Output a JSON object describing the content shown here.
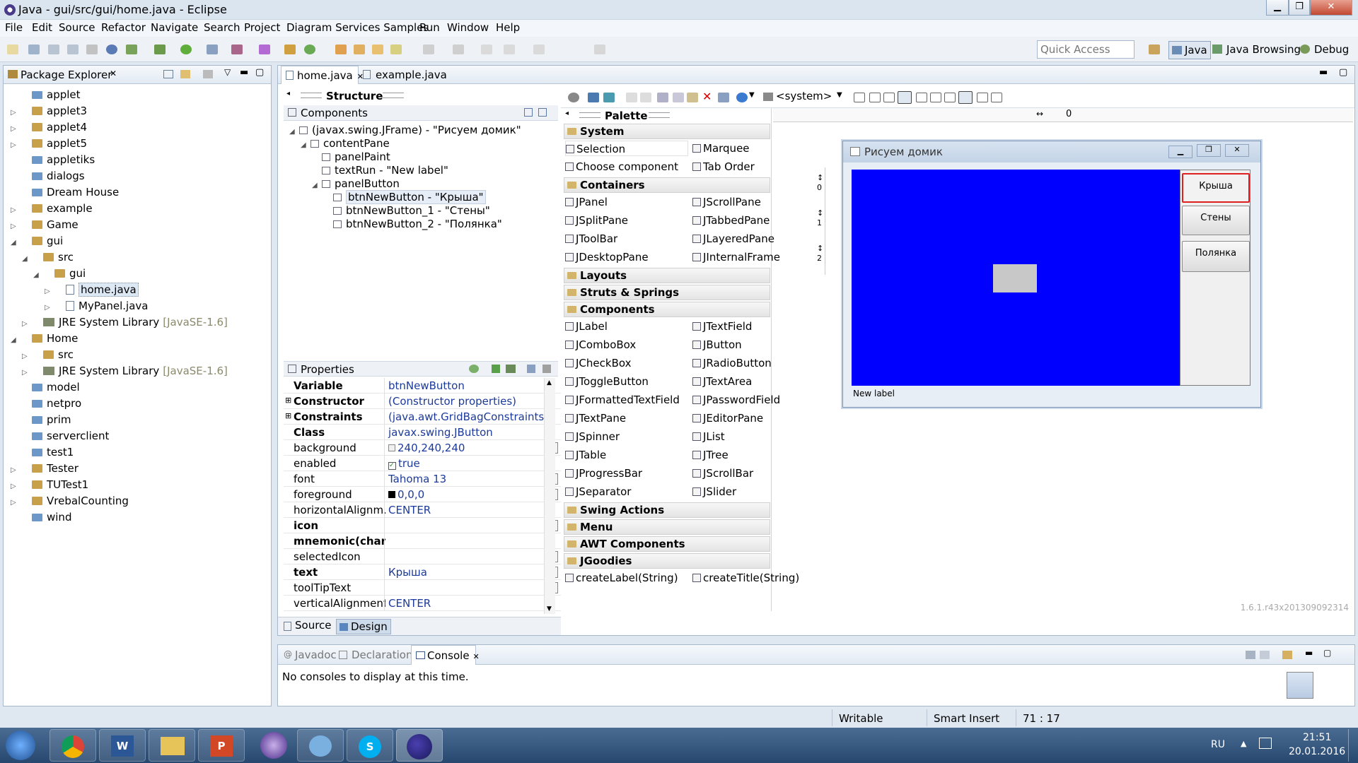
{
  "window": {
    "title": "Java - gui/src/gui/home.java - Eclipse"
  },
  "menu": [
    "File",
    "Edit",
    "Source",
    "Refactor",
    "Navigate",
    "Search",
    "Project",
    "Diagram Services Samples",
    "Run",
    "Window",
    "Help"
  ],
  "quick_access": {
    "placeholder": "Quick Access"
  },
  "perspectives": [
    "Java",
    "Java Browsing",
    "Debug"
  ],
  "package_explorer": {
    "title": "Package Explorer",
    "items": [
      {
        "label": "applet",
        "type": "folder",
        "indent": 0,
        "twisty": ""
      },
      {
        "label": "applet3",
        "type": "pkg",
        "indent": 0,
        "twisty": "▷"
      },
      {
        "label": "applet4",
        "type": "pkg",
        "indent": 0,
        "twisty": "▷"
      },
      {
        "label": "applet5",
        "type": "pkg",
        "indent": 0,
        "twisty": "▷"
      },
      {
        "label": "appletiks",
        "type": "folder",
        "indent": 0,
        "twisty": ""
      },
      {
        "label": "dialogs",
        "type": "folder",
        "indent": 0,
        "twisty": ""
      },
      {
        "label": "Dream House",
        "type": "folder",
        "indent": 0,
        "twisty": ""
      },
      {
        "label": "example",
        "type": "pkg",
        "indent": 0,
        "twisty": "▷"
      },
      {
        "label": "Game",
        "type": "pkg",
        "indent": 0,
        "twisty": "▷"
      },
      {
        "label": "gui",
        "type": "pkg",
        "indent": 0,
        "twisty": "◢"
      },
      {
        "label": "src",
        "type": "pkg",
        "indent": 1,
        "twisty": "◢"
      },
      {
        "label": "gui",
        "type": "pkg",
        "indent": 2,
        "twisty": "◢"
      },
      {
        "label": "home.java",
        "type": "java",
        "indent": 3,
        "twisty": "▷"
      },
      {
        "label": "MyPanel.java",
        "type": "java",
        "indent": 3,
        "twisty": "▷"
      },
      {
        "label": "JRE System Library",
        "suffix": "[JavaSE-1.6]",
        "type": "jre",
        "indent": 1,
        "twisty": "▷"
      },
      {
        "label": "Home",
        "type": "pkg",
        "indent": 0,
        "twisty": "◢"
      },
      {
        "label": "src",
        "type": "pkg",
        "indent": 1,
        "twisty": "▷"
      },
      {
        "label": "JRE System Library",
        "suffix": "[JavaSE-1.6]",
        "type": "jre",
        "indent": 1,
        "twisty": "▷"
      },
      {
        "label": "model",
        "type": "folder",
        "indent": 0,
        "twisty": ""
      },
      {
        "label": "netpro",
        "type": "folder",
        "indent": 0,
        "twisty": ""
      },
      {
        "label": "prim",
        "type": "folder",
        "indent": 0,
        "twisty": ""
      },
      {
        "label": "serverclient",
        "type": "folder",
        "indent": 0,
        "twisty": ""
      },
      {
        "label": "test1",
        "type": "folder",
        "indent": 0,
        "twisty": ""
      },
      {
        "label": "Tester",
        "type": "pkg",
        "indent": 0,
        "twisty": "▷"
      },
      {
        "label": "TUTest1",
        "type": "pkg",
        "indent": 0,
        "twisty": "▷"
      },
      {
        "label": "VrebalCounting",
        "type": "pkg",
        "indent": 0,
        "twisty": "▷"
      },
      {
        "label": "wind",
        "type": "folder",
        "indent": 0,
        "twisty": ""
      }
    ]
  },
  "editor_tabs": [
    "home.java",
    "example.java"
  ],
  "structure": {
    "title": "Structure",
    "components_title": "Components",
    "tree": [
      {
        "label": "(javax.swing.JFrame) - \"Рисуем домик\"",
        "indent": 0,
        "twisty": "◢"
      },
      {
        "label": "contentPane",
        "indent": 1,
        "twisty": "◢"
      },
      {
        "label": "panelPaint",
        "indent": 2,
        "twisty": ""
      },
      {
        "label": "textRun - \"New label\"",
        "indent": 2,
        "twisty": ""
      },
      {
        "label": "panelButton",
        "indent": 2,
        "twisty": "◢"
      },
      {
        "label": "btnNewButton - \"Крыша\"",
        "indent": 3,
        "twisty": ""
      },
      {
        "label": "btnNewButton_1 - \"Стены\"",
        "indent": 3,
        "twisty": ""
      },
      {
        "label": "btnNewButton_2 - \"Полянка\"",
        "indent": 3,
        "twisty": ""
      }
    ]
  },
  "properties": {
    "title": "Properties",
    "rows": [
      {
        "k": "Variable",
        "v": "btnNewButton",
        "bold": true,
        "dots": false,
        "plus": false
      },
      {
        "k": "Constructor",
        "v": "(Constructor properties)",
        "bold": true,
        "dots": false,
        "plus": true
      },
      {
        "k": "Constraints",
        "v": "(java.awt.GridBagConstraints)",
        "bold": true,
        "dots": false,
        "plus": true
      },
      {
        "k": "Class",
        "v": "javax.swing.JButton",
        "bold": true,
        "dots": false,
        "plus": false
      },
      {
        "k": "background",
        "v": "240,240,240",
        "bold": false,
        "dots": true,
        "plus": false
      },
      {
        "k": "enabled",
        "v": "true",
        "bold": false,
        "dots": false,
        "plus": false
      },
      {
        "k": "font",
        "v": "Tahoma 13",
        "bold": false,
        "dots": true,
        "plus": false
      },
      {
        "k": "foreground",
        "v": "0,0,0",
        "bold": false,
        "dots": true,
        "plus": false
      },
      {
        "k": "horizontalAlignm...",
        "v": "CENTER",
        "bold": false,
        "dots": false,
        "plus": false
      },
      {
        "k": "icon",
        "v": "",
        "bold": true,
        "dots": true,
        "plus": false
      },
      {
        "k": "mnemonic(char)",
        "v": "",
        "bold": true,
        "dots": false,
        "plus": false
      },
      {
        "k": "selectedIcon",
        "v": "",
        "bold": false,
        "dots": true,
        "plus": false
      },
      {
        "k": "text",
        "v": "Крыша",
        "bold": true,
        "dots": true,
        "plus": false
      },
      {
        "k": "toolTipText",
        "v": "",
        "bold": false,
        "dots": true,
        "plus": false
      },
      {
        "k": "verticalAlignment",
        "v": "CENTER",
        "bold": false,
        "dots": false,
        "plus": false
      }
    ]
  },
  "palette": {
    "title": "Palette",
    "system_label": "<system>",
    "sections": [
      {
        "name": "System",
        "items": [
          "Selection",
          "Marquee",
          "Choose component",
          "Tab Order"
        ]
      },
      {
        "name": "Containers",
        "items": [
          "JPanel",
          "JScrollPane",
          "JSplitPane",
          "JTabbedPane",
          "JToolBar",
          "JLayeredPane",
          "JDesktopPane",
          "JInternalFrame"
        ]
      },
      {
        "name": "Layouts",
        "items": []
      },
      {
        "name": "Struts & Springs",
        "items": []
      },
      {
        "name": "Components",
        "items": [
          "JLabel",
          "JTextField",
          "JComboBox",
          "JButton",
          "JCheckBox",
          "JRadioButton",
          "JToggleButton",
          "JTextArea",
          "JFormattedTextField",
          "JPasswordField",
          "JTextPane",
          "JEditorPane",
          "JSpinner",
          "JList",
          "JTable",
          "JTree",
          "JProgressBar",
          "JScrollBar",
          "JSeparator",
          "JSlider"
        ]
      },
      {
        "name": "Swing Actions",
        "items": []
      },
      {
        "name": "Menu",
        "items": []
      },
      {
        "name": "AWT Components",
        "items": []
      },
      {
        "name": "JGoodies",
        "items": [
          "createLabel(String)",
          "createTitle(String)"
        ]
      }
    ]
  },
  "design": {
    "ruler_value": "0",
    "row_markers": [
      "0",
      "1",
      "2"
    ],
    "frame_title": "Рисуем домик",
    "buttons": [
      "Крыша",
      "Стены",
      "Полянка"
    ],
    "label": "New label",
    "version": "1.6.1.r43x201309092314",
    "colors": {
      "paint_panel": "#0000ff",
      "rect": "#c8c8c8"
    }
  },
  "bottom_tabs": {
    "source": "Source",
    "design": "Design"
  },
  "console": {
    "tabs": [
      "Javadoc",
      "Declaration",
      "Console"
    ],
    "message": "No consoles to display at this time."
  },
  "status": {
    "writable": "Writable",
    "insert": "Smart Insert",
    "position": "71 : 17"
  },
  "taskbar": {
    "lang": "RU",
    "time": "21:51",
    "date": "20.01.2016"
  }
}
